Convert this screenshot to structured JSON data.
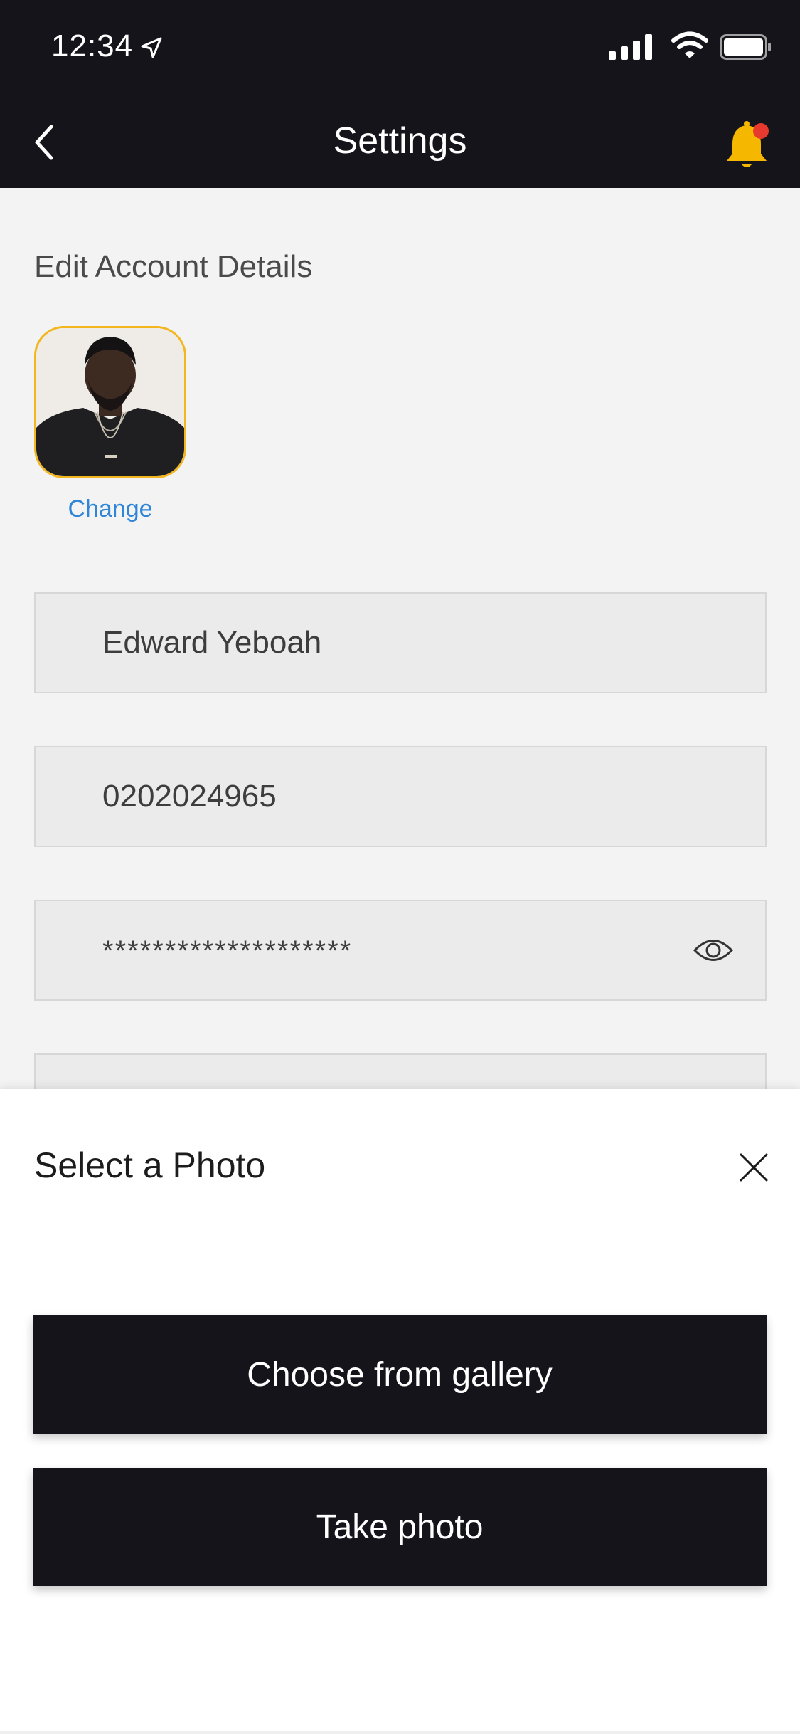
{
  "status_bar": {
    "time": "12:34"
  },
  "nav": {
    "title": "Settings",
    "notification_badge_color": "#e8392e",
    "bell_color": "#f5b700"
  },
  "account": {
    "section_title": "Edit Account Details",
    "change_label": "Change",
    "name_value": "Edward Yeboah",
    "phone_value": "0202024965",
    "password_value": "********************"
  },
  "sheet": {
    "title": "Select a Photo",
    "gallery_button_label": "Choose from gallery",
    "take_photo_button_label": "Take photo"
  },
  "colors": {
    "topbar_background": "#15141a",
    "page_background": "#f3f3f3",
    "accent": "#f3b61f",
    "link": "#2f86d8"
  },
  "icons": [
    "location-arrow-icon",
    "signal-icon",
    "wifi-icon",
    "battery-icon",
    "chevron-left-icon",
    "bell-icon",
    "eye-icon",
    "close-icon"
  ]
}
